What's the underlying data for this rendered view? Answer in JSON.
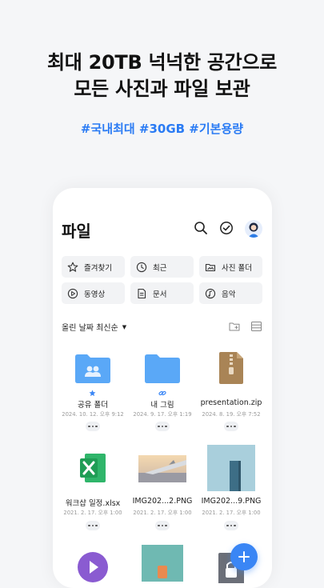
{
  "promo": {
    "headline_line1": "최대 20TB 넉넉한 공간으로",
    "headline_line2": "모든 사진과 파일 보관",
    "hashtags": "#국내최대 #30GB #기본용량"
  },
  "app": {
    "title": "파일",
    "top_icons": [
      "search-icon",
      "check-circle-icon",
      "profile-avatar"
    ],
    "quick_filters": [
      {
        "label": "즐겨찾기",
        "icon": "star-icon"
      },
      {
        "label": "최근",
        "icon": "clock-icon"
      },
      {
        "label": "사진 폴더",
        "icon": "image-folder-icon"
      },
      {
        "label": "동영상",
        "icon": "play-icon"
      },
      {
        "label": "문서",
        "icon": "document-icon"
      },
      {
        "label": "음악",
        "icon": "music-icon"
      }
    ],
    "sort_label": "올린 날짜 최신순",
    "files": [
      {
        "name": "공유 폴더",
        "date": "2024. 10. 12. 오후 9:12",
        "kind": "shared-folder",
        "badge": "star"
      },
      {
        "name": "내 그림",
        "date": "2024. 9. 17. 오후 1:19",
        "kind": "folder",
        "badge": "link"
      },
      {
        "name": "presentation.zip",
        "date": "2024. 8. 19. 오후 7:52",
        "kind": "zip"
      },
      {
        "name": "워크샵 일정.xlsx",
        "date": "2021. 2. 17. 오후 1:00",
        "kind": "excel"
      },
      {
        "name": "IMG202...2.PNG",
        "date": "2021. 2. 17. 오후 1:00",
        "kind": "photo-airplane"
      },
      {
        "name": "IMG202...9.PNG",
        "date": "2021. 2. 17. 오후 1:00",
        "kind": "photo-building"
      }
    ],
    "colors": {
      "accent": "#2a7bf4",
      "folder": "#5aa8f7",
      "excel": "#1f9d55",
      "zip": "#a98456",
      "video": "#8a5bd1"
    }
  }
}
